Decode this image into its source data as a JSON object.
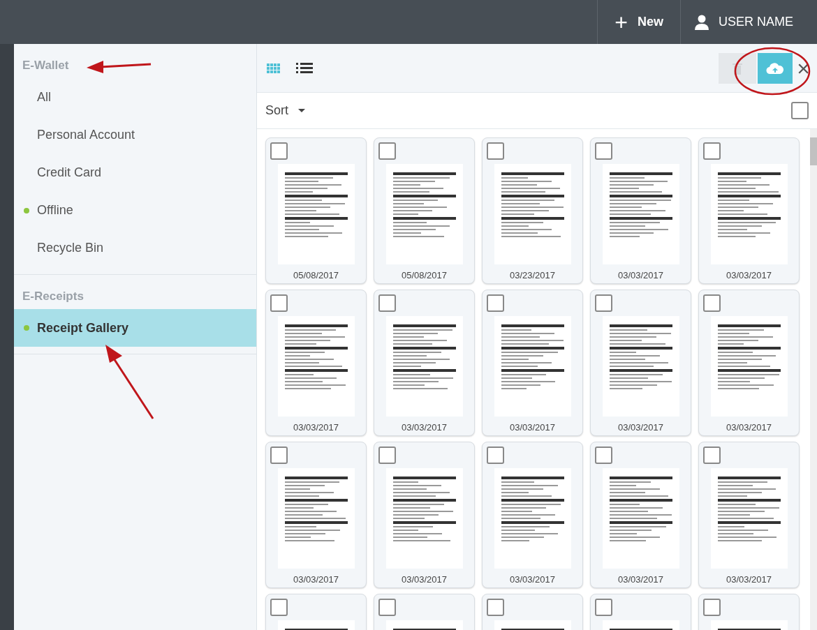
{
  "topbar": {
    "new_button": {
      "icon": "+",
      "label": "New"
    },
    "user": {
      "label": "USER NAME"
    }
  },
  "sidebar": {
    "sections": [
      {
        "title": "E-Wallet",
        "items": [
          {
            "label": "All",
            "selected": false,
            "dot": false
          },
          {
            "label": "Personal Account",
            "selected": false,
            "dot": false
          },
          {
            "label": "Credit Card",
            "selected": false,
            "dot": false
          },
          {
            "label": "Offline",
            "selected": false,
            "dot": true
          },
          {
            "label": "Recycle Bin",
            "selected": false,
            "dot": false
          }
        ]
      },
      {
        "title": "E-Receipts",
        "items": [
          {
            "label": "Receipt Gallery",
            "selected": true,
            "dot": true
          }
        ]
      }
    ]
  },
  "toolbar": {
    "views": [
      {
        "kind": "grid",
        "selected": true
      },
      {
        "kind": "list",
        "selected": false
      }
    ],
    "delete_disabled": true,
    "close": "×"
  },
  "sort": {
    "label": "Sort",
    "select_all_checked": false
  },
  "receipts": [
    {
      "date": "05/08/2017",
      "checked": false
    },
    {
      "date": "05/08/2017",
      "checked": false
    },
    {
      "date": "03/23/2017",
      "checked": false
    },
    {
      "date": "03/03/2017",
      "checked": false
    },
    {
      "date": "03/03/2017",
      "checked": false
    },
    {
      "date": "03/03/2017",
      "checked": false
    },
    {
      "date": "03/03/2017",
      "checked": false
    },
    {
      "date": "03/03/2017",
      "checked": false
    },
    {
      "date": "03/03/2017",
      "checked": false
    },
    {
      "date": "03/03/2017",
      "checked": false
    },
    {
      "date": "03/03/2017",
      "checked": false
    },
    {
      "date": "03/03/2017",
      "checked": false
    },
    {
      "date": "03/03/2017",
      "checked": false
    },
    {
      "date": "03/03/2017",
      "checked": false
    },
    {
      "date": "03/03/2017",
      "checked": false
    },
    {
      "checked": false
    },
    {
      "checked": false
    },
    {
      "checked": false
    },
    {
      "checked": false
    },
    {
      "checked": false
    }
  ]
}
